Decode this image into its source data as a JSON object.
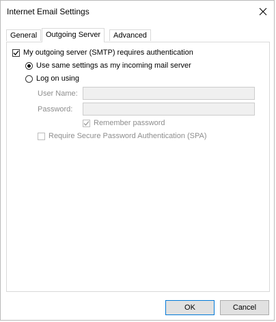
{
  "window": {
    "title": "Internet Email Settings"
  },
  "tabs": [
    {
      "label": "General"
    },
    {
      "label": "Outgoing Server"
    },
    {
      "label": "Advanced"
    }
  ],
  "outgoing": {
    "smtp_auth_label": "My outgoing server (SMTP) requires authentication",
    "smtp_auth_checked": true,
    "same_settings_label": "Use same settings as my incoming mail server",
    "same_settings_selected": true,
    "log_on_label": "Log on using",
    "log_on_selected": false,
    "username_label": "User Name:",
    "username_value": "",
    "password_label": "Password:",
    "password_value": "",
    "remember_label": "Remember password",
    "remember_checked": true,
    "spa_label": "Require Secure Password Authentication (SPA)",
    "spa_checked": false
  },
  "buttons": {
    "ok": "OK",
    "cancel": "Cancel"
  },
  "icons": {
    "close": "close-icon",
    "check": "checkmark-icon"
  }
}
